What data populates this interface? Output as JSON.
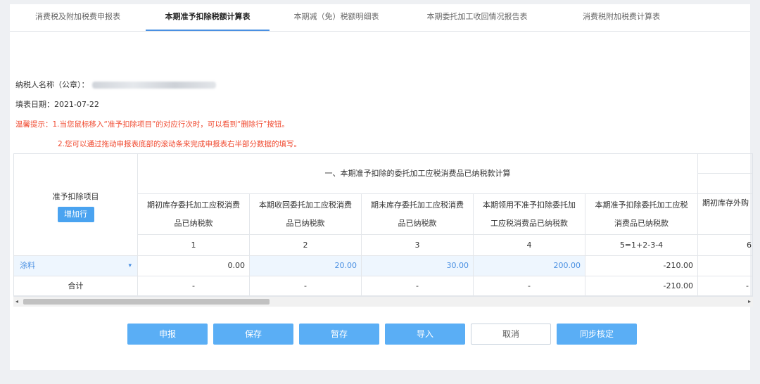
{
  "tabs": [
    {
      "label": "消费税及附加税费申报表"
    },
    {
      "label": "本期准予扣除税额计算表",
      "active": true
    },
    {
      "label": "本期减（免）税额明细表"
    },
    {
      "label": "本期委托加工收回情况报告表"
    },
    {
      "label": "消费税附加税费计算表"
    }
  ],
  "info": {
    "taxpayer_label": "纳税人名称（公章）：",
    "date_label": "填表日期：",
    "date_value": "2021-07-22"
  },
  "tips": {
    "line1": "温馨提示：1.当您鼠标移入“准予扣除项目”的对应行次时，可以看到“删除行”按钮。",
    "line2": "2.您可以通过拖动申报表底部的滚动条来完成申报表右半部分数据的填写。"
  },
  "table": {
    "row_header": "准予扣除项目",
    "add_row": "增加行",
    "group_header": "一、本期准予扣除的委托加工应税消费品已纳税款计算",
    "columns": [
      {
        "line1": "期初库存委托加工应税消费",
        "line2": "品已纳税款",
        "num": "1"
      },
      {
        "line1": "本期收回委托加工应税消费",
        "line2": "品已纳税款",
        "num": "2"
      },
      {
        "line1": "期末库存委托加工应税消费",
        "line2": "品已纳税款",
        "num": "3"
      },
      {
        "line1": "本期领用不准予扣除委托加",
        "line2": "工应税消费品已纳税款",
        "num": "4"
      },
      {
        "line1": "本期准予扣除委托加工应税",
        "line2": "消费品已纳税款",
        "num": "5=1+2-3-4"
      },
      {
        "line1": "期初库存外购",
        "line2": "",
        "num": "6"
      }
    ],
    "row1": {
      "item": "涂料",
      "dropdown": "▾",
      "values": [
        "0.00",
        "20.00",
        "30.00",
        "200.00",
        "-210.00",
        ""
      ]
    },
    "total": {
      "label": "合计",
      "values": [
        "-",
        "-",
        "-",
        "-",
        "-210.00",
        "-"
      ]
    }
  },
  "scroll": {
    "left": "◂",
    "right": "▸"
  },
  "buttons": {
    "submit": "申报",
    "save": "保存",
    "temp_save": "暂存",
    "import": "导入",
    "cancel": "取消",
    "sync": "同步核定"
  }
}
